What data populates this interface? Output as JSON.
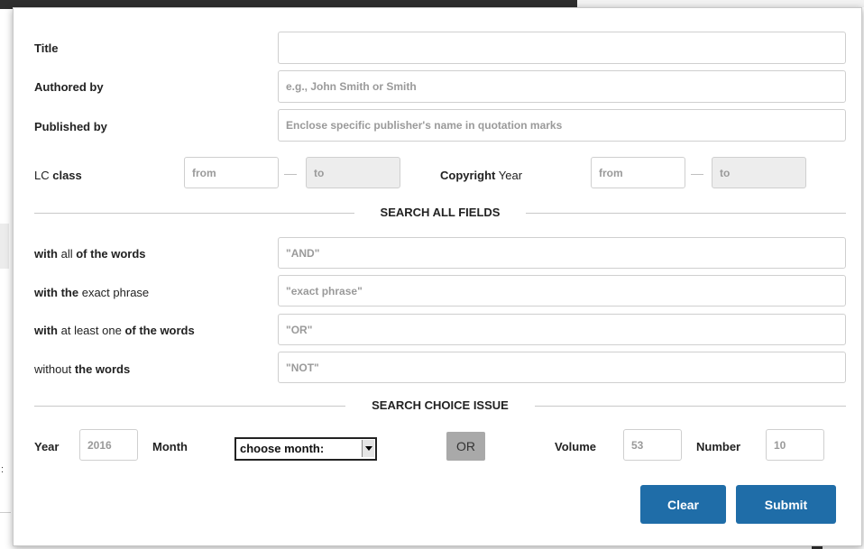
{
  "form": {
    "title_label": "Title",
    "authored_label_a": "Authored ",
    "authored_label_b": "by",
    "authored_placeholder": "e.g., John Smith or Smith",
    "published_label_a": "Published ",
    "published_label_b": "by",
    "published_placeholder": "Enclose specific publisher's name in quotation marks",
    "lc_label_a": "LC ",
    "lc_label_b": "class",
    "lc_from_placeholder": "from",
    "lc_to_placeholder": "to",
    "copyright_label_a": "Copyright",
    "copyright_label_b": " Year",
    "copyright_from_placeholder": "from",
    "copyright_to_placeholder": "to",
    "dash": "—"
  },
  "search_all": {
    "heading": "SEARCH ALL FIELDS",
    "all_words": {
      "a": "with",
      "b": " all ",
      "c": "of the words",
      "placeholder": "\"AND\""
    },
    "exact_phrase": {
      "a": "with the",
      "b": " exact phrase",
      "placeholder": "\"exact phrase\""
    },
    "one_of": {
      "a": "with",
      "b": " at least one ",
      "c": "of the words",
      "placeholder": "\"OR\""
    },
    "without": {
      "a": "without ",
      "b": "the words",
      "placeholder": "\"NOT\""
    }
  },
  "issue": {
    "heading": "SEARCH CHOICE ISSUE",
    "year_label": "Year",
    "year_placeholder": "2016",
    "month_label": "Month",
    "month_selected": "choose month:",
    "or_label": "OR",
    "volume_label": "Volume",
    "volume_placeholder": "53",
    "number_label": "Number",
    "number_placeholder": "10"
  },
  "buttons": {
    "clear": "Clear",
    "submit": "Submit"
  },
  "background": {
    "fragment_char": ":"
  },
  "colors": {
    "primary_button": "#1f6da8",
    "or_box": "#a9a9a9"
  }
}
